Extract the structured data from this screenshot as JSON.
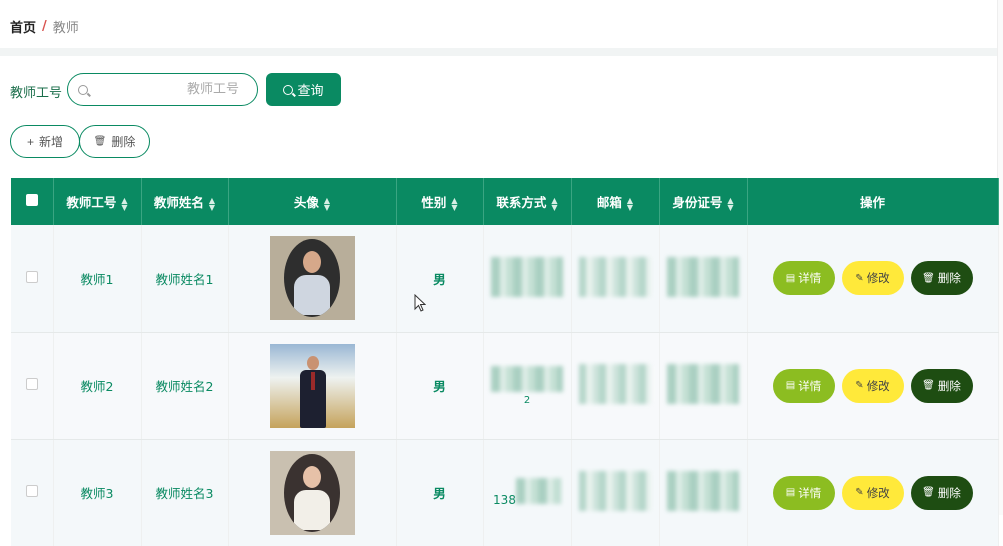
{
  "breadcrumb": {
    "home": "首页",
    "separator": "/",
    "current": "教师"
  },
  "search": {
    "label": "教师工号",
    "placeholder": "教师工号",
    "value": "",
    "button_label": "查询"
  },
  "toolbar": {
    "add_label": "新增",
    "delete_label": "删除"
  },
  "table": {
    "columns": [
      "教师工号",
      "教师姓名",
      "头像",
      "性别",
      "联系方式",
      "邮箱",
      "身份证号",
      "操作"
    ],
    "rows": [
      {
        "id": "教师1",
        "name": "教师姓名1",
        "gender": "男",
        "phone": "",
        "email": "",
        "idcard": ""
      },
      {
        "id": "教师2",
        "name": "教师姓名2",
        "gender": "男",
        "phone": "2",
        "email": "",
        "idcard": ""
      },
      {
        "id": "教师3",
        "name": "教师姓名3",
        "gender": "男",
        "phone": "138",
        "email": "",
        "idcard": ""
      }
    ],
    "actions": {
      "detail": "详情",
      "edit": "修改",
      "delete": "删除"
    }
  },
  "colors": {
    "primary": "#0a8a62",
    "detail": "#8cbd21",
    "edit": "#ffe93a",
    "delete": "#1e4d12"
  },
  "icons": [
    "search-icon",
    "plus-icon",
    "trash-icon",
    "sort-icon",
    "doc-icon",
    "pencil-icon"
  ]
}
